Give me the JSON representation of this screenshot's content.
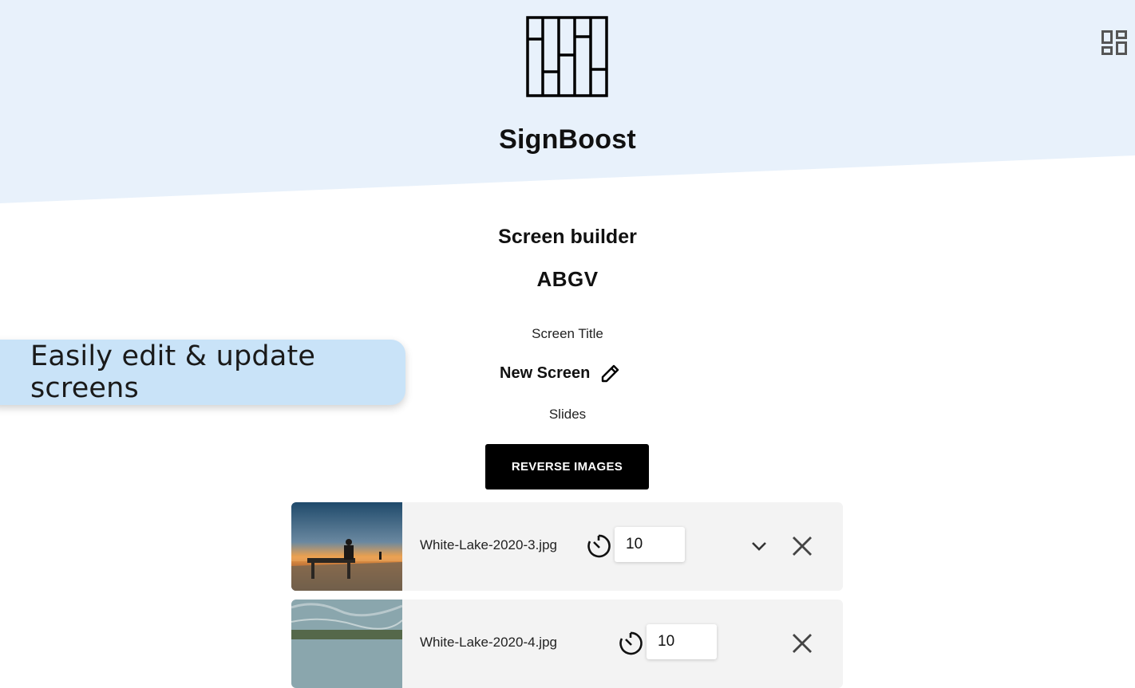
{
  "app": {
    "name": "SignBoost"
  },
  "builder": {
    "heading": "Screen builder",
    "screen_code": "ABGV",
    "title_label": "Screen Title",
    "title_value": "New Screen",
    "slides_label": "Slides",
    "reverse_label": "REVERSE IMAGES"
  },
  "promo": {
    "text": "Easily edit & update screens"
  },
  "slides": [
    {
      "filename": "White-Lake-2020-3.jpg",
      "duration": "10"
    },
    {
      "filename": "White-Lake-2020-4.jpg",
      "duration": "10"
    }
  ],
  "colors": {
    "header_bg": "#e8f1fb",
    "promo_bg": "#c9e3f8",
    "primary_button": "#000000",
    "row_bg": "#f3f3f3"
  },
  "icons": [
    "dashboard-icon",
    "edit-pencil-icon",
    "timer-icon",
    "chevron-down-icon",
    "close-icon"
  ]
}
